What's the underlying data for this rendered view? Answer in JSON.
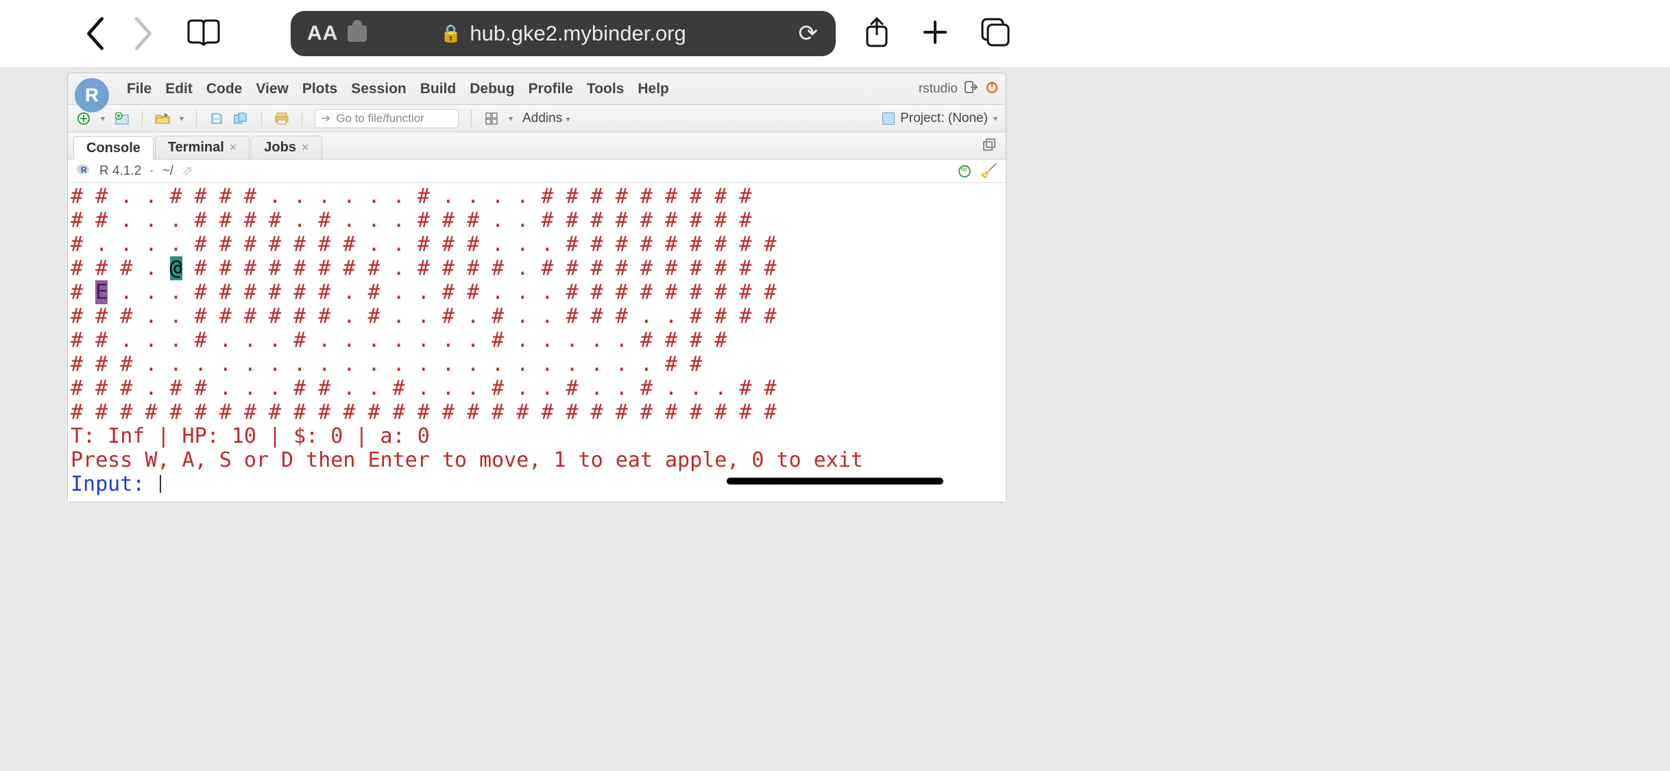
{
  "safari": {
    "url_display": "hub.gke2.mybinder.org",
    "aa": "AA"
  },
  "rstudio": {
    "brand": "R",
    "menu": [
      "File",
      "Edit",
      "Code",
      "View",
      "Plots",
      "Session",
      "Build",
      "Debug",
      "Profile",
      "Tools",
      "Help"
    ],
    "rstudio_label": "rstudio",
    "go_to_placeholder": "Go to file/functior",
    "addins": "Addins",
    "project": "Project: (None)",
    "tabs": [
      {
        "label": "Console",
        "closable": false,
        "active": true
      },
      {
        "label": "Terminal",
        "closable": true,
        "active": false
      },
      {
        "label": "Jobs",
        "closable": true,
        "active": false
      }
    ],
    "status": {
      "version": "R 4.1.2",
      "sep": "·",
      "cwd": "~/"
    }
  },
  "console": {
    "map": [
      "# # . . # # # # . . . . . . # . . . . # # # # # # # # #",
      "# # . . . # # # # . # . . . # # # . . # # # # # # # # #",
      "# . . . . # # # # # # # . . # # # . . . # # # # # # # # #",
      "# # # . @ # # # # # # # # . # # # # . # # # # # # # # # #",
      "# E . . . # # # # # # . # . . # # . . . # # # # # # # # #",
      "# # # . . # # # # # # . # . . # . # . . # # # . . # # # #",
      "# # . . . # . . . # . . . . . . . # . . . . . # # # #",
      "# # # . . . . . . . . . . . . . . . . . . . . . # #",
      "# # # . # # . . . # # . . # . . . # . . # . . # . . . # #",
      "# # # # # # # # # # # # # # # # # # # # # # # # # # # # #"
    ],
    "status_line": "T: Inf | HP: 10 | $: 0 | a: 0",
    "help_line": "Press W, A, S or D then Enter to move, 1 to eat apple, 0 to exit",
    "prompt": "Input: "
  }
}
